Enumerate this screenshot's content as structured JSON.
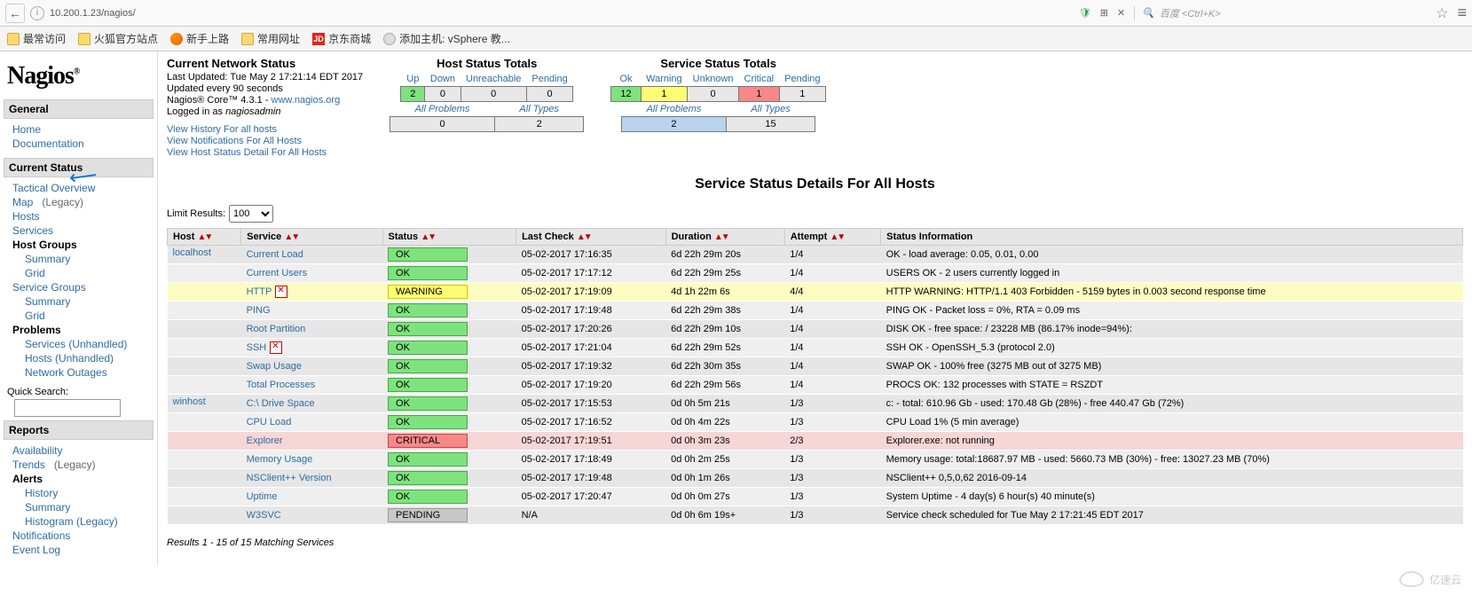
{
  "browser": {
    "url": "10.200.1.23/nagios/",
    "search_placeholder": "百度 <Ctrl+K>",
    "shield": "🛡",
    "qr": "⊞",
    "close": "✕",
    "search_icon": "🔍",
    "star": "☆",
    "menu": "≡"
  },
  "bookmarks": {
    "most_visited": "最常访问",
    "firefox_site": "火狐官方站点",
    "getting_started": "新手上路",
    "common_sites": "常用网址",
    "jd": "京东商城",
    "jd_badge": "JD",
    "vsphere": "添加主机: vSphere 教..."
  },
  "logo": "Nagios",
  "sidebar": {
    "general": "General",
    "home": "Home",
    "documentation": "Documentation",
    "current_status": "Current Status",
    "tactical": "Tactical Overview",
    "map": "Map",
    "legacy": "(Legacy)",
    "hosts": "Hosts",
    "services": "Services",
    "host_groups": "Host Groups",
    "summary": "Summary",
    "grid": "Grid",
    "service_groups": "Service Groups",
    "problems": "Problems",
    "services_unhandled": "Services (Unhandled)",
    "hosts_unhandled": "Hosts (Unhandled)",
    "network_outages": "Network Outages",
    "quick_search": "Quick Search:",
    "reports": "Reports",
    "availability": "Availability",
    "trends": "Trends",
    "alerts": "Alerts",
    "history": "History",
    "histogram": "Histogram (Legacy)",
    "notifications": "Notifications",
    "event_log": "Event Log"
  },
  "status": {
    "title": "Current Network Status",
    "last_updated": "Last Updated: Tue May 2 17:21:14 EDT 2017",
    "update_every": "Updated every 90 seconds",
    "core_text": "Nagios® Core™ 4.3.1 - ",
    "core_link": "www.nagios.org",
    "logged_in_pre": "Logged in as ",
    "logged_in_user": "nagiosadmin",
    "link1": "View History For all hosts",
    "link2": "View Notifications For All Hosts",
    "link3": "View Host Status Detail For All Hosts"
  },
  "host_totals": {
    "title": "Host Status Totals",
    "h_up": "Up",
    "h_down": "Down",
    "h_unreach": "Unreachable",
    "h_pending": "Pending",
    "up": "2",
    "down": "0",
    "unreach": "0",
    "pending": "0",
    "all_problems": "All Problems",
    "all_types": "All Types",
    "problems": "0",
    "types": "2"
  },
  "service_totals": {
    "title": "Service Status Totals",
    "h_ok": "Ok",
    "h_warn": "Warning",
    "h_unknown": "Unknown",
    "h_crit": "Critical",
    "h_pending": "Pending",
    "ok": "12",
    "warn": "1",
    "unknown": "0",
    "crit": "1",
    "pending": "1",
    "all_problems": "All Problems",
    "all_types": "All Types",
    "problems": "2",
    "types": "15"
  },
  "page_title": "Service Status Details For All Hosts",
  "limit": {
    "label": "Limit Results:",
    "value": "100"
  },
  "table": {
    "h_host": "Host",
    "h_service": "Service",
    "h_status": "Status",
    "h_last": "Last Check",
    "h_dur": "Duration",
    "h_attempt": "Attempt",
    "h_info": "Status Information"
  },
  "rows": [
    {
      "host": "localhost",
      "showhost": true,
      "rowclass": "even",
      "svc": "Current Load",
      "status": "OK",
      "stclass": "st-ok",
      "last": "05-02-2017 17:16:35",
      "dur": "6d 22h 29m 20s",
      "att": "1/4",
      "info": "OK - load average: 0.05, 0.01, 0.00",
      "notif": false
    },
    {
      "host": "",
      "showhost": false,
      "rowclass": "odd",
      "svc": "Current Users",
      "status": "OK",
      "stclass": "st-ok",
      "last": "05-02-2017 17:17:12",
      "dur": "6d 22h 29m 25s",
      "att": "1/4",
      "info": "USERS OK - 2 users currently logged in",
      "notif": false
    },
    {
      "host": "",
      "showhost": false,
      "rowclass": "row-warn",
      "svc": "HTTP",
      "status": "WARNING",
      "stclass": "st-warn",
      "last": "05-02-2017 17:19:09",
      "dur": "4d 1h 22m 6s",
      "att": "4/4",
      "info": "HTTP WARNING: HTTP/1.1 403 Forbidden - 5159 bytes in 0.003 second response time",
      "notif": true
    },
    {
      "host": "",
      "showhost": false,
      "rowclass": "odd",
      "svc": "PING",
      "status": "OK",
      "stclass": "st-ok",
      "last": "05-02-2017 17:19:48",
      "dur": "6d 22h 29m 38s",
      "att": "1/4",
      "info": "PING OK - Packet loss = 0%, RTA = 0.09 ms",
      "notif": false
    },
    {
      "host": "",
      "showhost": false,
      "rowclass": "even",
      "svc": "Root Partition",
      "status": "OK",
      "stclass": "st-ok",
      "last": "05-02-2017 17:20:26",
      "dur": "6d 22h 29m 10s",
      "att": "1/4",
      "info": "DISK OK - free space: / 23228 MB (86.17% inode=94%):",
      "notif": false
    },
    {
      "host": "",
      "showhost": false,
      "rowclass": "odd",
      "svc": "SSH",
      "status": "OK",
      "stclass": "st-ok",
      "last": "05-02-2017 17:21:04",
      "dur": "6d 22h 29m 52s",
      "att": "1/4",
      "info": "SSH OK - OpenSSH_5.3 (protocol 2.0)",
      "notif": true
    },
    {
      "host": "",
      "showhost": false,
      "rowclass": "even",
      "svc": "Swap Usage",
      "status": "OK",
      "stclass": "st-ok",
      "last": "05-02-2017 17:19:32",
      "dur": "6d 22h 30m 35s",
      "att": "1/4",
      "info": "SWAP OK - 100% free (3275 MB out of 3275 MB)",
      "notif": false
    },
    {
      "host": "",
      "showhost": false,
      "rowclass": "odd",
      "svc": "Total Processes",
      "status": "OK",
      "stclass": "st-ok",
      "last": "05-02-2017 17:19:20",
      "dur": "6d 22h 29m 56s",
      "att": "1/4",
      "info": "PROCS OK: 132 processes with STATE = RSZDT",
      "notif": false
    },
    {
      "host": "winhost",
      "showhost": true,
      "rowclass": "even",
      "svc": "C:\\ Drive Space",
      "status": "OK",
      "stclass": "st-ok",
      "last": "05-02-2017 17:15:53",
      "dur": "0d 0h 5m 21s",
      "att": "1/3",
      "info": "c: - total: 610.96 Gb - used: 170.48 Gb (28%) - free 440.47 Gb (72%)",
      "notif": false
    },
    {
      "host": "",
      "showhost": false,
      "rowclass": "odd",
      "svc": "CPU Load",
      "status": "OK",
      "stclass": "st-ok",
      "last": "05-02-2017 17:16:52",
      "dur": "0d 0h 4m 22s",
      "att": "1/3",
      "info": "CPU Load 1% (5 min average)",
      "notif": false
    },
    {
      "host": "",
      "showhost": false,
      "rowclass": "row-crit",
      "svc": "Explorer",
      "status": "CRITICAL",
      "stclass": "st-crit",
      "last": "05-02-2017 17:19:51",
      "dur": "0d 0h 3m 23s",
      "att": "2/3",
      "info": "Explorer.exe: not running",
      "notif": false
    },
    {
      "host": "",
      "showhost": false,
      "rowclass": "odd",
      "svc": "Memory Usage",
      "status": "OK",
      "stclass": "st-ok",
      "last": "05-02-2017 17:18:49",
      "dur": "0d 0h 2m 25s",
      "att": "1/3",
      "info": "Memory usage: total:18687.97 MB - used: 5660.73 MB (30%) - free: 13027.23 MB (70%)",
      "notif": false
    },
    {
      "host": "",
      "showhost": false,
      "rowclass": "even",
      "svc": "NSClient++ Version",
      "status": "OK",
      "stclass": "st-ok",
      "last": "05-02-2017 17:19:48",
      "dur": "0d 0h 1m 26s",
      "att": "1/3",
      "info": "NSClient++ 0,5,0,62 2016-09-14",
      "notif": false
    },
    {
      "host": "",
      "showhost": false,
      "rowclass": "odd",
      "svc": "Uptime",
      "status": "OK",
      "stclass": "st-ok",
      "last": "05-02-2017 17:20:47",
      "dur": "0d 0h 0m 27s",
      "att": "1/3",
      "info": "System Uptime - 4 day(s) 6 hour(s) 40 minute(s)",
      "notif": false
    },
    {
      "host": "",
      "showhost": false,
      "rowclass": "even",
      "svc": "W3SVC",
      "status": "PENDING",
      "stclass": "st-pend",
      "last": "N/A",
      "dur": "0d 0h 6m 19s+",
      "att": "1/3",
      "info": "Service check scheduled for Tue May 2 17:21:45 EDT 2017",
      "notif": false
    }
  ],
  "results_footer": "Results 1 - 15 of 15 Matching Services",
  "watermark": "亿速云"
}
